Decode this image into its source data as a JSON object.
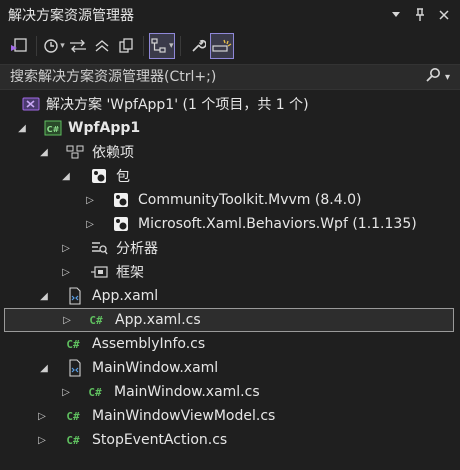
{
  "titlebar": {
    "title": "解决方案资源管理器",
    "dropdown_icon": "chevron-down-icon",
    "pin_icon": "pin-icon",
    "close_icon": "close-icon"
  },
  "toolbar": {
    "icons": [
      "switch-views-icon",
      "history-icon",
      "sync-icon",
      "collapse-all-icon",
      "copy-icon",
      "show-tree-icon",
      "properties-wrench-icon",
      "preview-selected-icon"
    ]
  },
  "search": {
    "placeholder": "搜索解决方案资源管理器(Ctrl+;)",
    "icon": "search-icon"
  },
  "tree": {
    "solution": "解决方案 'WpfApp1' (1 个项目，共 1 个)",
    "project": "WpfApp1",
    "dependencies": "依赖项",
    "packages": "包",
    "pkg1": "CommunityToolkit.Mvvm (8.4.0)",
    "pkg2": "Microsoft.Xaml.Behaviors.Wpf (1.1.135)",
    "analyzers": "分析器",
    "frameworks": "框架",
    "app_xaml": "App.xaml",
    "app_xaml_cs": "App.xaml.cs",
    "assemblyinfo": "AssemblyInfo.cs",
    "mainwindow_xaml": "MainWindow.xaml",
    "mainwindow_xaml_cs": "MainWindow.xaml.cs",
    "viewmodel": "MainWindowViewModel.cs",
    "stopevent": "StopEventAction.cs",
    "cs_badge": "C#"
  },
  "colors": {
    "background": "#1f1f1f",
    "csharp_green": "#5fbf5f",
    "solution_purple": "#a36ae8",
    "selection_border": "#9a9a9a"
  }
}
